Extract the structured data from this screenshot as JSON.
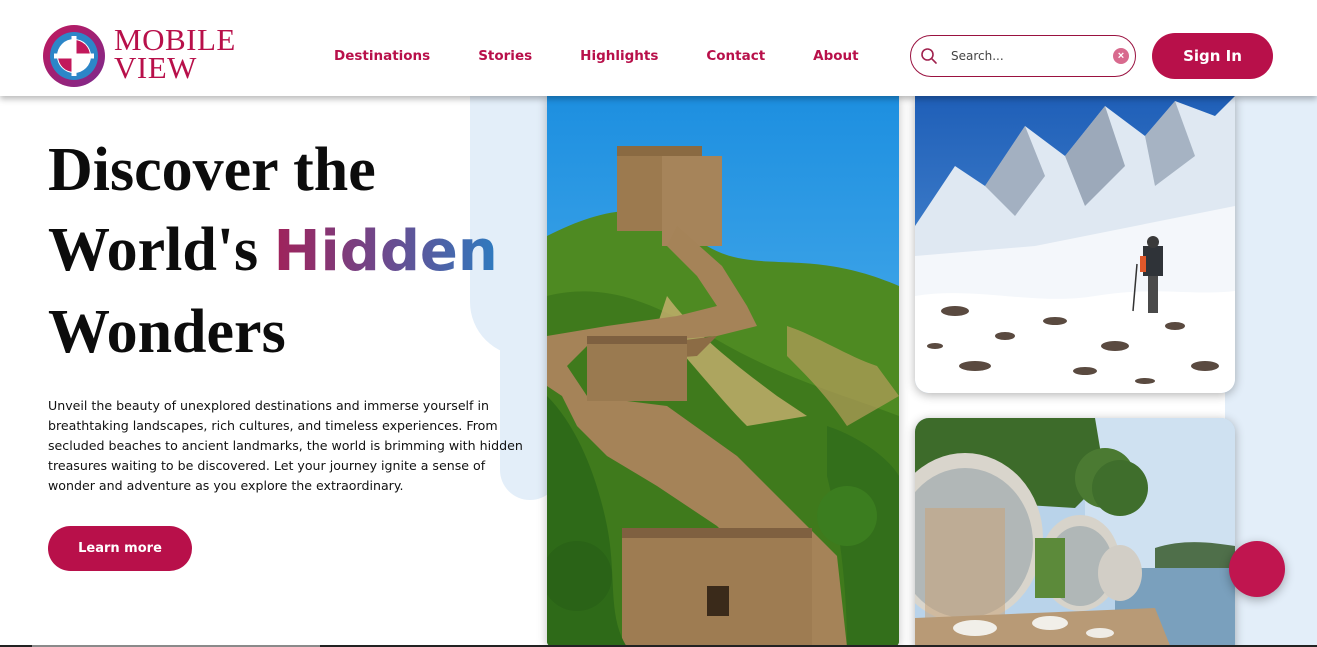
{
  "brand": {
    "line1": "MOBILE",
    "line2": "VIEW",
    "logo_icon": "compass-globe-icon",
    "color": "#b8104a"
  },
  "nav": {
    "items": [
      {
        "label": "Destinations"
      },
      {
        "label": "Stories"
      },
      {
        "label": "Highlights"
      },
      {
        "label": "Contact"
      },
      {
        "label": "About"
      }
    ]
  },
  "search": {
    "placeholder": "Search...",
    "icon": "search-icon",
    "clear_icon": "close-icon",
    "clear_glyph": "×"
  },
  "header": {
    "signin_label": "Sign In"
  },
  "hero": {
    "title_line1": "Discover the",
    "title_line2_prefix": "World's ",
    "title_highlight": "Hidden",
    "title_line3": "Wonders",
    "description": "Unveil the beauty of unexplored destinations and immerse yourself in breathtaking landscapes, rich cultures, and timeless experiences. From secluded beaches to ancient landmarks, the world is brimming with hidden treasures waiting to be discovered. Let your journey ignite a sense of wonder and adventure as you explore the extraordinary.",
    "cta_label": "Learn more"
  },
  "gallery": {
    "images": [
      {
        "name": "great-wall-image"
      },
      {
        "name": "snowy-mountain-hiker-image"
      },
      {
        "name": "lakeside-glass-pods-image"
      }
    ]
  },
  "colors": {
    "accent": "#b8104a",
    "gradient_start": "#a0225a",
    "gradient_end": "#2e7bc0",
    "blob": "#e3eef9"
  }
}
